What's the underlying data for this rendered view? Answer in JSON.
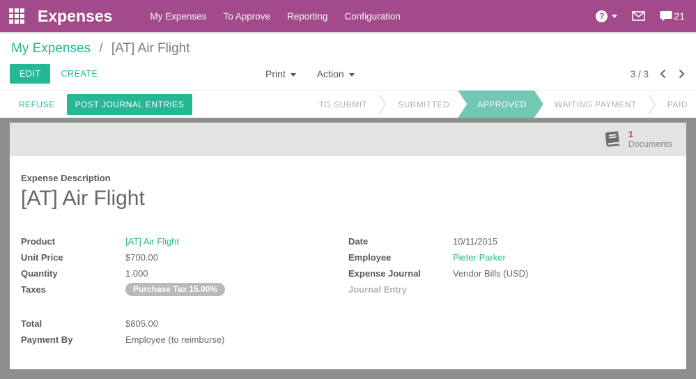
{
  "colors": {
    "brand_purple": "#a34a8b",
    "accent_teal": "#26b795",
    "approved_teal": "#72c8b2",
    "backdrop_gray": "#8f8f8f"
  },
  "nav": {
    "app_title": "Expenses",
    "menu": [
      {
        "label": "My Expenses"
      },
      {
        "label": "To Approve"
      },
      {
        "label": "Reporting"
      },
      {
        "label": "Configuration"
      }
    ],
    "help_glyph": "?",
    "message_count": "21"
  },
  "breadcrumb": {
    "parent": "My Expenses",
    "separator": "/",
    "current": "[AT] Air Flight"
  },
  "control_panel": {
    "edit_label": "EDIT",
    "create_label": "CREATE",
    "print_label": "Print",
    "action_label": "Action",
    "pager": "3 / 3"
  },
  "statusbar": {
    "refuse_label": "REFUSE",
    "post_label": "POST JOURNAL ENTRIES",
    "states": [
      {
        "label": "TO SUBMIT",
        "active": false
      },
      {
        "label": "SUBMITTED",
        "active": false
      },
      {
        "label": "APPROVED",
        "active": true
      },
      {
        "label": "WAITING PAYMENT",
        "active": false
      },
      {
        "label": "PAID",
        "active": false
      }
    ]
  },
  "sheet": {
    "documents": {
      "count": "1",
      "label": "Documents"
    },
    "description_label": "Expense Description",
    "title": "[AT] Air Flight",
    "fields_left": [
      {
        "label": "Product",
        "value": "[AT] Air Flight"
      },
      {
        "label": "Unit Price",
        "value": "$700.00"
      },
      {
        "label": "Quantity",
        "value": "1.000"
      },
      {
        "label": "Taxes",
        "value": "Purchase Tax 15.00%"
      }
    ],
    "fields_right": [
      {
        "label": "Date",
        "value": "10/11/2015"
      },
      {
        "label": "Employee",
        "value": "Pieter Parker"
      },
      {
        "label": "Expense Journal",
        "value": "Vendor Bills (USD)"
      },
      {
        "label": "Journal Entry",
        "value": ""
      }
    ],
    "totals": [
      {
        "label": "Total",
        "value": "$805.00"
      },
      {
        "label": "Payment By",
        "value": "Employee (to reimburse)"
      }
    ]
  }
}
